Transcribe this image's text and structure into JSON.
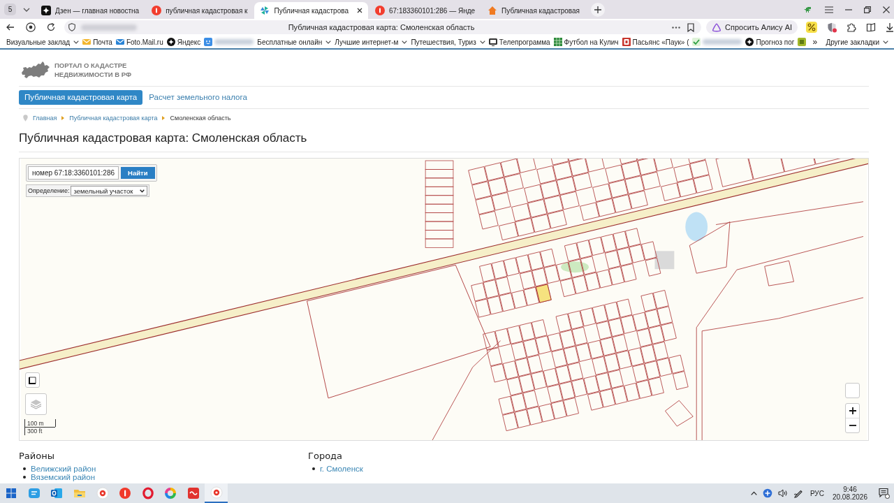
{
  "browser": {
    "profile": "5",
    "tabs": [
      {
        "title": "Дзен — главная новостна",
        "selected": false
      },
      {
        "title": "публичная кадастровая к",
        "selected": false
      },
      {
        "title": "Публичная кадастрова",
        "selected": true
      },
      {
        "title": "67:183360101:286 — Янде",
        "selected": false
      },
      {
        "title": "Публичная кадастровая",
        "selected": false
      }
    ],
    "page_title": "Публичная кадастровая карта: Смоленская область",
    "assistant_button": "Спросить Алису AI",
    "bookmarks": [
      {
        "kind": "folder",
        "label": "Визуальные заклад"
      },
      {
        "kind": "link",
        "label": "Почта"
      },
      {
        "kind": "link",
        "label": "Foto.Mail.ru"
      },
      {
        "kind": "link",
        "label": "Яндекс"
      },
      {
        "kind": "hidden"
      },
      {
        "kind": "folder",
        "label": "Бесплатные онлайн"
      },
      {
        "kind": "folder",
        "label": "Лучшие интернет-м"
      },
      {
        "kind": "folder",
        "label": "Путешествия, Туриз"
      },
      {
        "kind": "link",
        "label": "Телепрограмма"
      },
      {
        "kind": "link",
        "label": "Футбол на Кулич"
      },
      {
        "kind": "link",
        "label": "Пасьянс «Паук» ("
      },
      {
        "kind": "hidden"
      },
      {
        "kind": "link",
        "label": "Прогноз пог"
      },
      {
        "kind": "icon"
      }
    ],
    "bookmarks_overflow": "»",
    "other_bookmarks": "Другие закладки"
  },
  "site": {
    "logo": [
      "ПОРТАЛ О КАДАСТРЕ",
      "НЕДВИЖИМОСТИ В РФ"
    ],
    "nav": [
      {
        "label": "Публичная кадастровая карта",
        "selected": true
      },
      {
        "label": "Расчет земельного налога",
        "selected": false
      }
    ],
    "breadcrumbs": [
      {
        "label": "Главная",
        "current": false
      },
      {
        "label": "Публичная кадастровая карта",
        "current": false
      },
      {
        "label": "Смоленская область",
        "current": true
      }
    ],
    "heading": "Публичная кадастровая карта: Смоленская область",
    "map": {
      "search_value": "номер 67:18:3360101:286",
      "search_button": "Найти",
      "definition_label": "Определение:",
      "definition_value": "земельный участок",
      "scale": [
        "100 m",
        "300 ft"
      ]
    },
    "sections": [
      {
        "title": "Районы",
        "links": [
          "Велижский район",
          "Вяземский район"
        ]
      },
      {
        "title": "Города",
        "links": [
          "г. Смоленск"
        ]
      }
    ]
  },
  "taskbar": {
    "apps": [
      {
        "selected": false
      },
      {
        "selected": false
      },
      {
        "selected": false
      },
      {
        "selected": false
      },
      {
        "selected": false
      },
      {
        "selected": false
      },
      {
        "selected": false
      },
      {
        "selected": false
      },
      {
        "selected": true
      }
    ],
    "language": "РУС",
    "time": "9:46",
    "date": "20.08.2026"
  }
}
